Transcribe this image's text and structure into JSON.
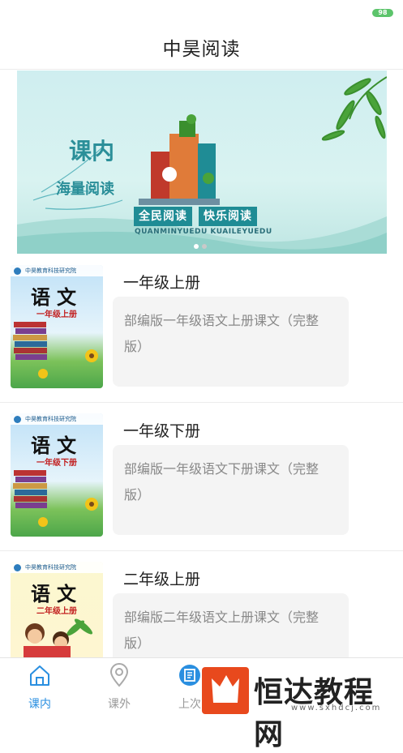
{
  "status_bar": {
    "battery": "98"
  },
  "header": {
    "title": "中昊阅读"
  },
  "banner": {
    "heading_1": "课内",
    "heading_2": "海量阅读",
    "slogan_1": "全民阅读",
    "slogan_2": "快乐阅读",
    "pinyin": "QUANMINYUEDU KUAILEYUEDU",
    "page_count": 2,
    "active_page": 1
  },
  "books": [
    {
      "title": "一年级上册",
      "description": "部编版一年级语文上册课文（完整版）",
      "cover": {
        "institute": "中昊教育科技研究院",
        "subject": "语文",
        "grade": "一年级上册"
      }
    },
    {
      "title": "一年级下册",
      "description": "部编版一年级语文下册课文（完整版）",
      "cover": {
        "institute": "中昊教育科技研究院",
        "subject": "语文",
        "grade": "一年级下册"
      }
    },
    {
      "title": "二年级上册",
      "description": "部编版二年级语文上册课文（完整版）",
      "cover": {
        "institute": "中昊教育科技研究院",
        "subject": "语文",
        "grade": "二年级上册"
      }
    }
  ],
  "tab_bar": {
    "tabs": [
      {
        "label": "课内",
        "icon": "home-icon",
        "active": true
      },
      {
        "label": "课外",
        "icon": "location-pin-icon",
        "active": false
      },
      {
        "label": "上次",
        "icon": "book-icon",
        "active": false
      }
    ]
  },
  "watermark": {
    "text": "恒达教程网",
    "url": "www.sxhdcj.com"
  },
  "colors": {
    "accent": "#2a8fe0",
    "banner_teal": "#1f8c95",
    "watermark_red": "#e8491d"
  }
}
